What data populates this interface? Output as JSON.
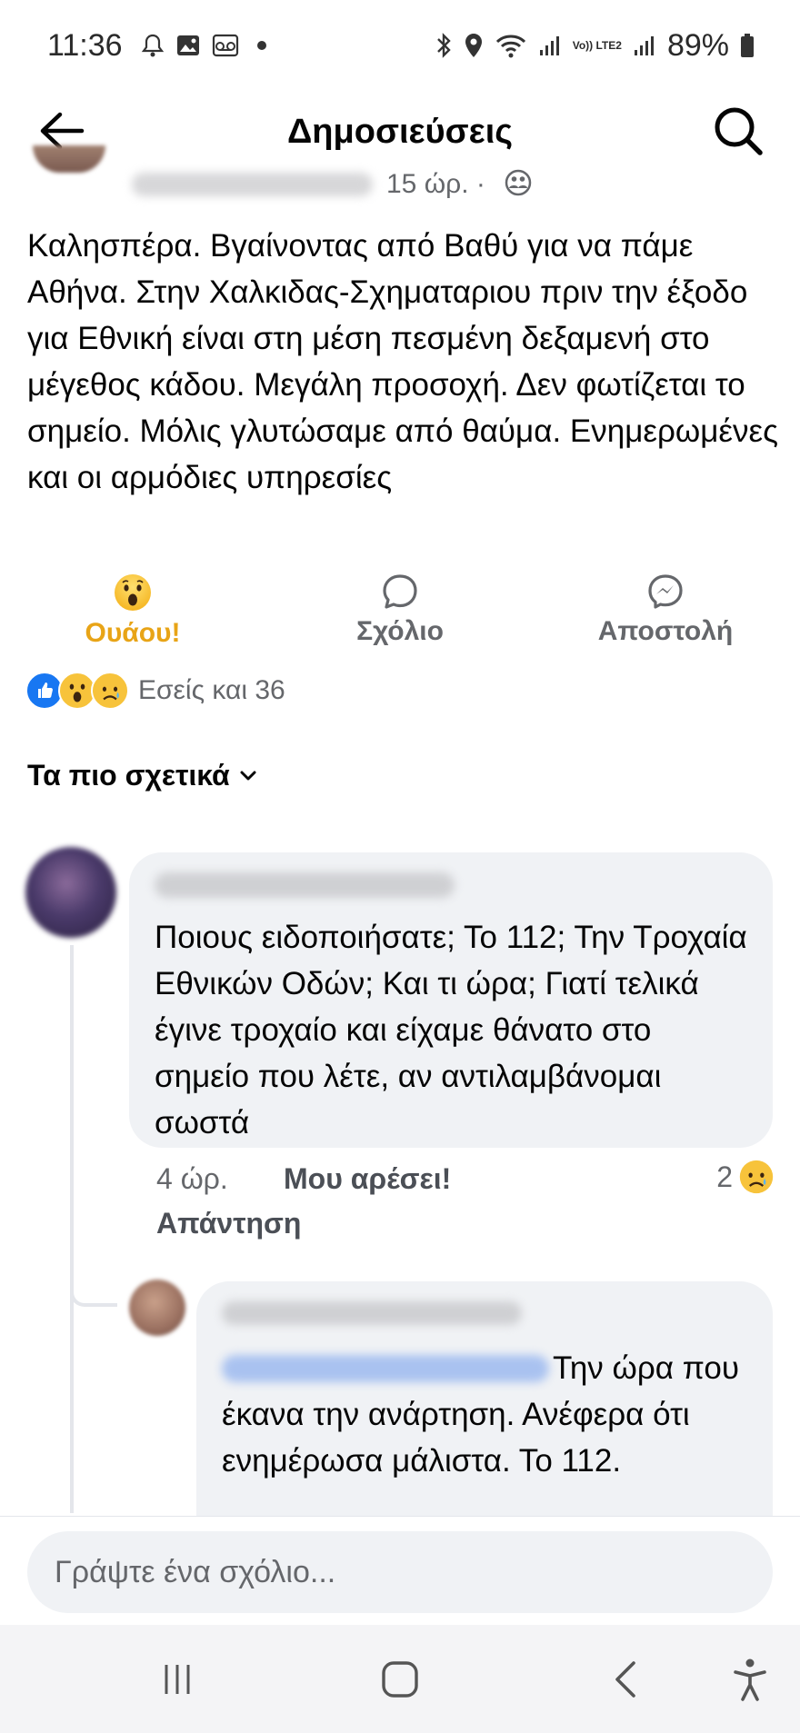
{
  "status_bar": {
    "time": "11:36",
    "battery": "89%",
    "network_label": "Vo)) LTE2"
  },
  "header": {
    "title": "Δημοσιεύσεις"
  },
  "post": {
    "time": "15 ώρ. ·",
    "text": "Καλησπέρα. Βγαίνοντας από Βαθύ για να πάμε Αθήνα. Στην Χαλκιδας-Σχηματαριου πριν την έξοδο για Εθνική είναι στη μέση πεσμένη δεξαμενή στο μέγεθος κάδου. Μεγάλη προσοχή. Δεν φωτίζεται το σημείο. Μόλις γλυτώσαμε από θαύμα. Ενημερωμένες και οι αρμόδιες υπηρεσίες"
  },
  "actions": {
    "wow_label": "Ουάου!",
    "comment_label": "Σχόλιο",
    "send_label": "Αποστολή"
  },
  "reactions": {
    "summary": "Εσείς και 36"
  },
  "sort": {
    "label": "Τα πιο σχετικά"
  },
  "comments": [
    {
      "text": "Ποιους ειδοποιήσατε; Το 112; Την Τροχαία Εθνικών Οδών; Και τι ώρα; Γιατί τελικά έγινε τροχαίο και είχαμε θάνατο στο σημείο που λέτε, αν αντιλαμβάνομαι σωστά",
      "time": "4 ώρ.",
      "like_label": "Μου αρέσει!",
      "reply_label": "Απάντηση",
      "reaction_count": "2"
    },
    {
      "text": "Την ώρα που έκανα την ανάρτηση. Ανέφερα ότι ενημέρωσα μάλιστα. Το 112."
    }
  ],
  "composer": {
    "placeholder": "Γράψτε ένα σχόλιο..."
  },
  "colors": {
    "wow_accent": "#e8a417",
    "secondary_text": "#65676b",
    "bubble_bg": "#f0f2f5",
    "like_blue": "#1877f2"
  },
  "icons": [
    "notification-bell-icon",
    "gallery-icon",
    "voicemail-icon",
    "bluetooth-icon",
    "location-icon",
    "wifi-icon",
    "signal-icon",
    "battery-icon",
    "back-arrow-icon",
    "search-icon",
    "friends-audience-icon",
    "wow-emoji-icon",
    "comment-icon",
    "messenger-icon",
    "like-reaction-icon",
    "sad-reaction-icon",
    "chevron-down-icon",
    "recents-icon",
    "home-icon",
    "nav-back-icon",
    "accessibility-icon"
  ]
}
